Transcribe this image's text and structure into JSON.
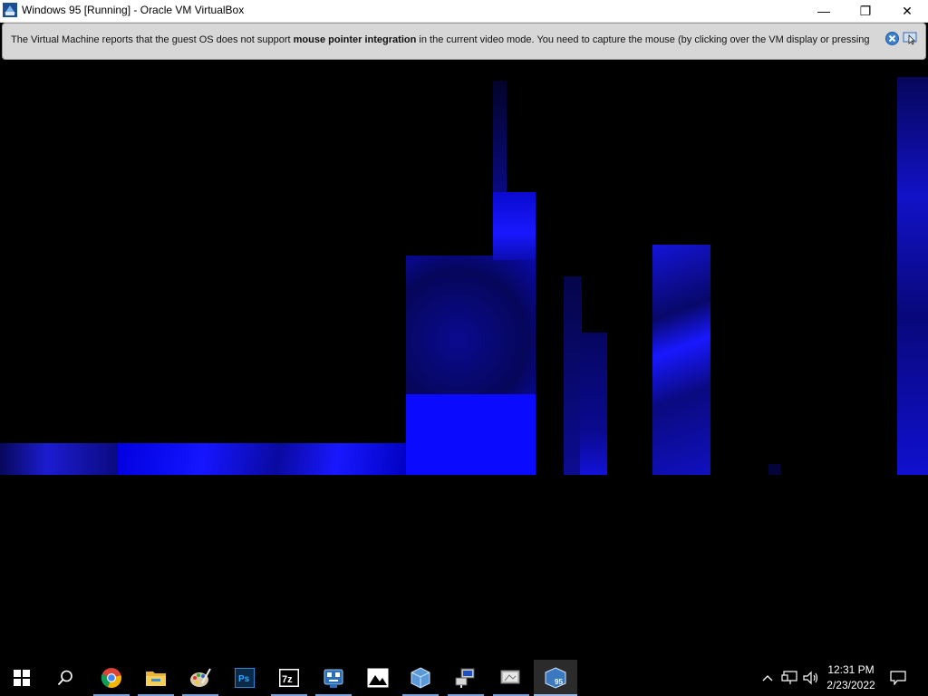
{
  "window": {
    "title": "Windows 95 [Running] - Oracle VM VirtualBox",
    "minimize_glyph": "—",
    "restore_glyph": "❐",
    "close_glyph": "✕"
  },
  "banner": {
    "text_before": "The Virtual Machine reports that the guest OS does not support ",
    "text_bold": "mouse pointer integration",
    "text_after": " in the current video mode. You need to capture the mouse (by clicking over the VM display or pressing"
  },
  "taskbar": {
    "items": [
      {
        "name": "start-button",
        "icon": "windows-logo-icon"
      },
      {
        "name": "search-button",
        "icon": "search-icon"
      },
      {
        "name": "chrome",
        "icon": "chrome-icon"
      },
      {
        "name": "file-explorer",
        "icon": "folder-icon"
      },
      {
        "name": "paint",
        "icon": "paint-palette-icon"
      },
      {
        "name": "photoshop",
        "icon": "photoshop-icon",
        "label": "Ps"
      },
      {
        "name": "7zip",
        "icon": "7zip-icon",
        "label": "7z"
      },
      {
        "name": "app-robot",
        "icon": "robot-icon"
      },
      {
        "name": "photos",
        "icon": "image-icon"
      },
      {
        "name": "virtualbox-manager",
        "icon": "virtualbox-icon"
      },
      {
        "name": "network-tool",
        "icon": "network-computer-icon"
      },
      {
        "name": "display-settings",
        "icon": "monitor-icon"
      },
      {
        "name": "windows95-vm",
        "icon": "windows95-vm-icon",
        "label": "95",
        "active": true
      }
    ],
    "tray": {
      "time": "12:31 PM",
      "date": "2/23/2022"
    }
  },
  "colors": {
    "vm_background": "#000000",
    "guest_blue": "#1010ff",
    "taskbar": "#000000",
    "banner": "#d7d7d7"
  }
}
